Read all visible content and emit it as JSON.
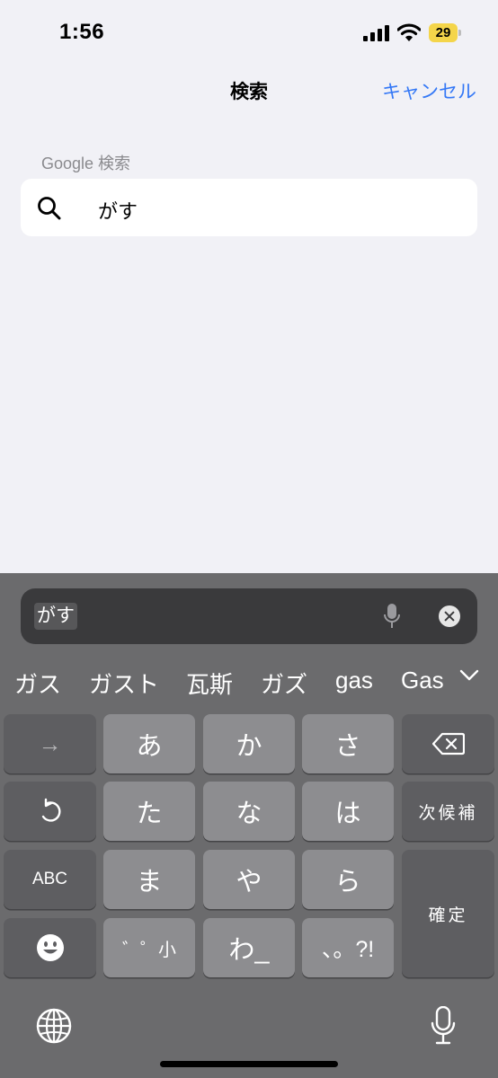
{
  "status": {
    "time": "1:56",
    "battery": "29"
  },
  "nav": {
    "title": "検索",
    "cancel": "キャンセル"
  },
  "search": {
    "section_label": "Google 検索",
    "query": "がす"
  },
  "keyboard": {
    "input_text": "がす",
    "candidates": [
      "ガス",
      "ガスト",
      "瓦斯",
      "ガズ",
      "gas",
      "Gas"
    ],
    "keys": {
      "arrow": "→",
      "a": "あ",
      "ka": "か",
      "sa": "さ",
      "undo": "↺",
      "ta": "た",
      "na": "な",
      "ha": "は",
      "next_candidate": "次候補",
      "abc": "ABC",
      "ma": "ま",
      "ya": "や",
      "ra": "ら",
      "confirm": "確定",
      "emoji": "☻",
      "dakuten": "゛゜小",
      "wa": "わ_",
      "punct": "、。?!"
    }
  },
  "colors": {
    "accent": "#3478f6",
    "battery": "#f4d54a",
    "keyboard_bg": "#6b6b6d",
    "key_light": "#8d8d90",
    "key_dark": "#5e5e61"
  }
}
